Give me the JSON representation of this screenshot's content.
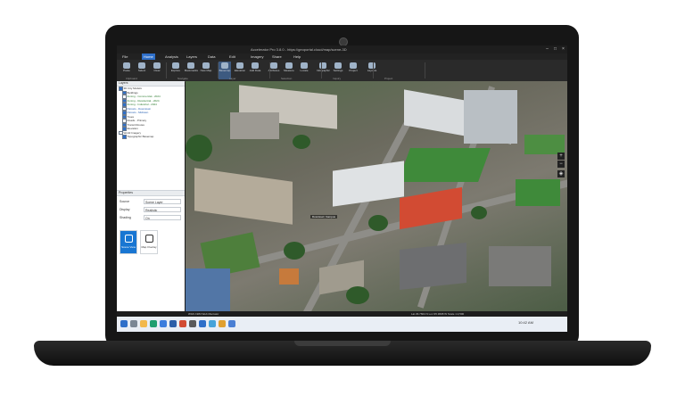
{
  "window": {
    "title": "Accelerator Pro 3.8.0 - https://geoportal.cloud/map/scene-3D"
  },
  "menu": [
    "File",
    "Home",
    "Analysis",
    "Layers",
    "Data",
    "Edit",
    "Imagery",
    "Share",
    "Help"
  ],
  "menu_active_index": 1,
  "ribbon": {
    "buttons": [
      "Paste",
      "Select",
      "Clear",
      "Explore",
      "Bookmarks",
      "New Map",
      "Basemap",
      "Elevation",
      "Add Data",
      "Attributes",
      "Measure",
      "Locate",
      "Infographic",
      "Settings",
      "Project",
      "Layouts"
    ],
    "groups": [
      "Clipboard",
      "Navigate",
      "Layer",
      "Selection",
      "Inquiry",
      "Project"
    ]
  },
  "panel": {
    "title": "Layers",
    "layers": [
      {
        "label": "3D City Models",
        "style": "normal"
      },
      {
        "label": "Buildings",
        "style": "normal"
      },
      {
        "label": "Zoning - Commercial - 2024",
        "style": "green"
      },
      {
        "label": "Zoning - Residential - 2024",
        "style": "green"
      },
      {
        "label": "Zoning - Industrial - 2024",
        "style": "green"
      },
      {
        "label": "Parcels - Downtown",
        "style": "blue"
      },
      {
        "label": "Parcels - Midtown",
        "style": "blue"
      },
      {
        "label": "Trees",
        "style": "normal"
      },
      {
        "label": "Roads - Primary",
        "style": "normal"
      },
      {
        "label": "Transit Routes",
        "style": "normal"
      },
      {
        "label": "Elevation",
        "style": "normal"
      },
      {
        "label": "World Imagery",
        "style": "normal"
      },
      {
        "label": "Topographic Basemap",
        "style": "normal"
      }
    ],
    "props_title": "Properties",
    "props": [
      {
        "label": "Source",
        "value": "Scene Layer"
      },
      {
        "label": "Display",
        "value": "Realistic"
      },
      {
        "label": "Shading",
        "value": "On"
      }
    ],
    "tiles": [
      "Scene View",
      "Map Overlay"
    ]
  },
  "map": {
    "callout": "Downtown Campus"
  },
  "status": {
    "left": "WGS 1984 Web Mercator",
    "right": "Lat 29.7604 N  Lon 95.3698 W   Scale 1:2,500"
  },
  "bottom_tabs": [
    "Map",
    "Data",
    "Layer",
    "Table"
  ],
  "tray": {
    "clock": "10:42 AM"
  },
  "colors": {
    "accent": "#2e6fc9",
    "selected_tile": "#1976d2",
    "laptop_body": "#161616",
    "red_roof": "#d24b33"
  }
}
